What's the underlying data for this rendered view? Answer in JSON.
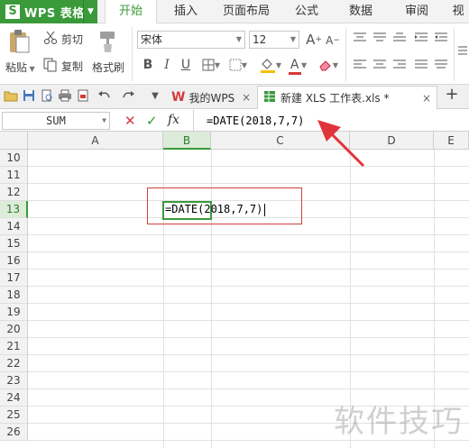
{
  "app": {
    "name": "WPS 表格",
    "logo_letter": "S"
  },
  "menu_tabs": [
    "开始",
    "插入",
    "页面布局",
    "公式",
    "数据",
    "审阅",
    "视"
  ],
  "active_menu_tab": "开始",
  "ribbon": {
    "paste_label": "粘贴",
    "cut_label": "剪切",
    "copy_label": "复制",
    "format_painter_label": "格式刷",
    "font_name": "宋体",
    "font_size": "12",
    "grow_font": "A",
    "shrink_font": "A",
    "bold": "B",
    "italic": "I",
    "underline": "U",
    "font_color_letter": "A",
    "font_color": "#d43a3a",
    "fill_color": "#f2c200"
  },
  "doc_tabs": [
    {
      "label": "我的WPS",
      "close": "×"
    },
    {
      "label": "新建 XLS 工作表.xls *",
      "close": "×"
    }
  ],
  "new_tab_label": "+",
  "formula_bar": {
    "name_box": "SUM",
    "cancel_glyph": "✕",
    "enter_glyph": "✓",
    "fx_label": "fx",
    "formula": "=DATE(2018,7,7)"
  },
  "grid": {
    "columns": [
      "A",
      "B",
      "C",
      "D",
      "E"
    ],
    "selected_column": "B",
    "rows": [
      "10",
      "11",
      "12",
      "13",
      "14",
      "15",
      "16",
      "17",
      "18",
      "19",
      "20",
      "21",
      "22",
      "23",
      "24",
      "25",
      "26"
    ],
    "selected_row": "13",
    "active_cell": "B13",
    "active_cell_content": "=DATE(2018,7,7)"
  },
  "colors": {
    "accent": "#3a9a3a",
    "highlight": "#d0403a"
  },
  "watermark": "软件技巧"
}
